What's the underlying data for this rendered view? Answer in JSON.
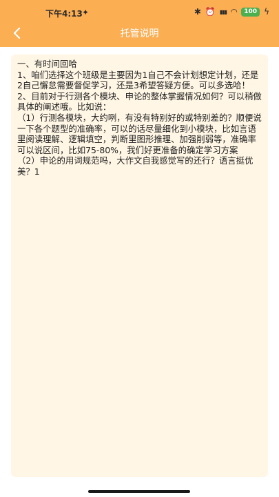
{
  "status_bar": {
    "time": "下午4:13",
    "location_glyph": "✦",
    "bluetooth_glyph": "✱",
    "alarm_glyph": "⏰",
    "signal_glyph": "▮▮▮",
    "wifi_glyph": "◠",
    "battery_level": "100",
    "charging_glyph": "ϟ"
  },
  "nav": {
    "title": "托管说明",
    "back_icon": "chevron-left-icon"
  },
  "content": {
    "text": "一、有时间回哈\n1、咱们选择这个班级是主要因为1自己不会计划想定计划，还是2自己懈怠需要督促学习，还是3希望答疑方便。可以多选哈！\n2、目前对于行测各个模块、申论的整体掌握情况如何？可以稍做具体的阐述哦。比如说：\n（1）行测各模块，大约咧，有没有特别好的或特别差的？顺便说一下各个题型的准确率，可以的话尽量细化到小模块，比如言语里阅读理解、逻辑填空，判断里图形推理、加强削弱等，准确率可以说区间，比如75-80%，我们好更准备的确定学习方案\n（2）申论的用词规范吗，大作文自我感觉写的还行？语言挺优美？1"
  },
  "colors": {
    "header_bg": "#fcae53",
    "card_bg": "#fff6e5",
    "text": "#222222",
    "battery": "#4caf50"
  }
}
